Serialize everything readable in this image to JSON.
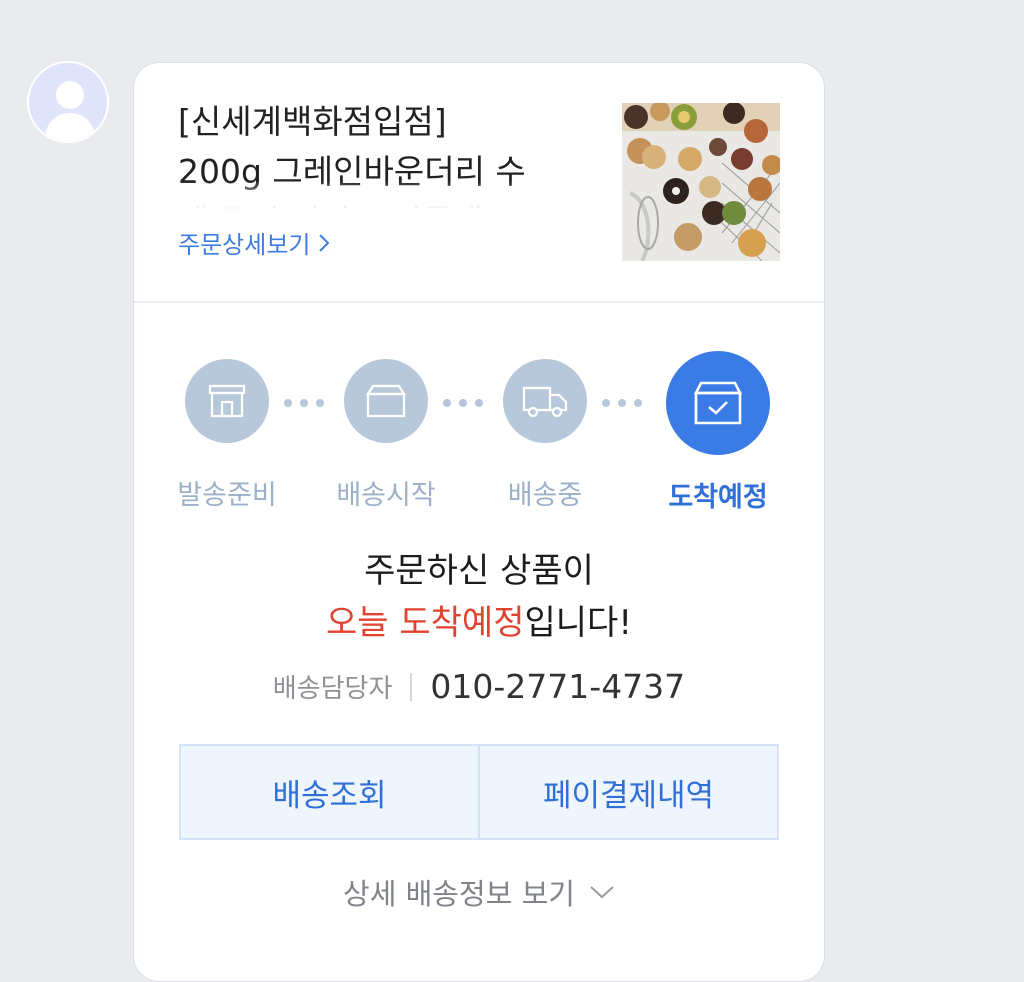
{
  "product": {
    "title_line1": "[신세계백화점입점]",
    "title_line2": "200g 그레인바운더리 수",
    "title_line3": "제 쿠키 디저트 선물세트",
    "detail_link": "주문상세보기",
    "image_icon": "cookie-product-photo"
  },
  "steps": [
    {
      "label": "발송준비",
      "icon": "store-icon",
      "active": false
    },
    {
      "label": "배송시작",
      "icon": "box-icon",
      "active": false
    },
    {
      "label": "배송중",
      "icon": "truck-icon",
      "active": false
    },
    {
      "label": "도착예정",
      "icon": "box-check-icon",
      "active": true
    }
  ],
  "message": {
    "line1": "주문하신 상품이",
    "highlight": "오늘 도착예정",
    "line2_suffix": "입니다!"
  },
  "contact": {
    "label": "배송담당자",
    "phone": "010-2771-4737"
  },
  "buttons": {
    "track": "배송조회",
    "pay_history": "페이결제내역"
  },
  "more_info": "상세 배송정보 보기",
  "colors": {
    "accent": "#3b7be6",
    "highlight": "#e0432f",
    "inactive_step": "#b8c8db"
  }
}
